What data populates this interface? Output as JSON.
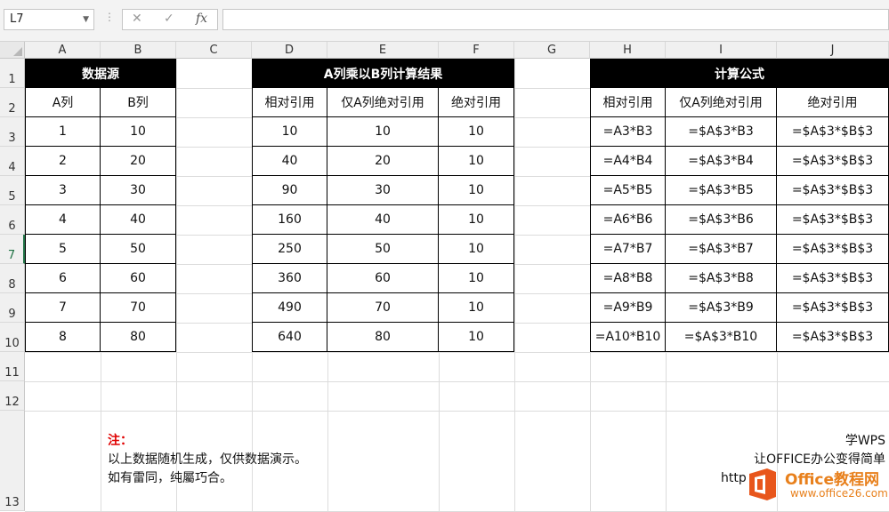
{
  "formula_bar": {
    "name_box": "L7",
    "cancel_glyph": "✕",
    "confirm_glyph": "✓",
    "fx_label": "fx",
    "formula": ""
  },
  "columns": [
    "A",
    "B",
    "C",
    "D",
    "E",
    "F",
    "G",
    "H",
    "I",
    "J"
  ],
  "rows": [
    "1",
    "2",
    "3",
    "4",
    "5",
    "6",
    "7",
    "8",
    "9",
    "10",
    "11",
    "12",
    "13"
  ],
  "source": {
    "title": "数据源",
    "headers": [
      "A列",
      "B列"
    ],
    "a": [
      "1",
      "2",
      "3",
      "4",
      "5",
      "6",
      "7",
      "8"
    ],
    "b": [
      "10",
      "20",
      "30",
      "40",
      "50",
      "60",
      "70",
      "80"
    ]
  },
  "result": {
    "title": "A列乘以B列计算结果",
    "headers": [
      "相对引用",
      "仅A列绝对引用",
      "绝对引用"
    ],
    "relative": [
      "10",
      "40",
      "90",
      "160",
      "250",
      "360",
      "490",
      "640"
    ],
    "a_abs": [
      "10",
      "20",
      "30",
      "40",
      "50",
      "60",
      "70",
      "80"
    ],
    "abs": [
      "10",
      "10",
      "10",
      "10",
      "10",
      "10",
      "10",
      "10"
    ]
  },
  "formulas": {
    "title": "计算公式",
    "headers": [
      "相对引用",
      "仅A列绝对引用",
      "绝对引用"
    ],
    "relative": [
      "=A3*B3",
      "=A4*B4",
      "=A5*B5",
      "=A6*B6",
      "=A7*B7",
      "=A8*B8",
      "=A9*B9",
      "=A10*B10"
    ],
    "a_abs": [
      "=$A$3*B3",
      "=$A$3*B4",
      "=$A$3*B5",
      "=$A$3*B6",
      "=$A$3*B7",
      "=$A$3*B8",
      "=$A$3*B9",
      "=$A$3*B10"
    ],
    "abs": [
      "=$A$3*$B$3",
      "=$A$3*$B$3",
      "=$A$3*$B$3",
      "=$A$3*$B$3",
      "=$A$3*$B$3",
      "=$A$3*$B$3",
      "=$A$3*$B$3",
      "=$A$3*$B$3"
    ]
  },
  "note": {
    "label": "注：",
    "line1": "以上数据随机生成，仅供数据演示。",
    "line2": "如有雷同，纯屬巧合。"
  },
  "promo": {
    "line1": "学WPS",
    "line2": "让OFFICE办公变得简单",
    "line3": "http"
  },
  "watermark": {
    "title": "Office教程网",
    "url": "www.office26.com",
    "color": "#e8801c"
  }
}
